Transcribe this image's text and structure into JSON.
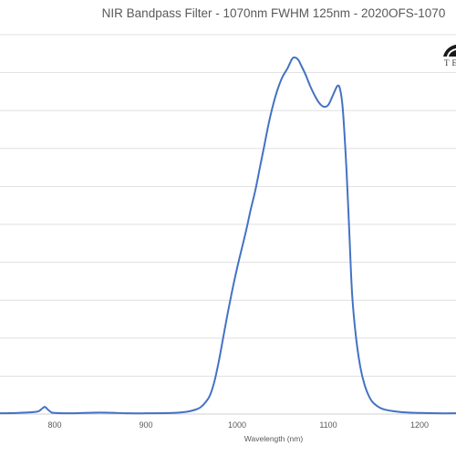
{
  "chart_data": {
    "type": "line",
    "title": "NIR Bandpass Filter - 1070nm FWHM 125nm - 2020OFS-1070",
    "xlabel": "Wavelength (nm)",
    "ylabel": "",
    "xlim": [
      740,
      1240
    ],
    "ylim": [
      0,
      100
    ],
    "x_ticks": [
      800,
      900,
      1000,
      1100,
      1200
    ],
    "x_tick_labels": [
      "800",
      "900",
      "1000",
      "1100",
      "1200"
    ],
    "y_gridlines": [
      0,
      10,
      20,
      30,
      40,
      50,
      60,
      70,
      80,
      90,
      100
    ],
    "grid": "horizontal",
    "legend": "none",
    "series": [
      {
        "color": "#4472C4",
        "x": [
          740,
          760,
          780,
          785,
          789,
          792,
          796,
          800,
          820,
          850,
          880,
          900,
          930,
          945,
          955,
          960,
          965,
          970,
          975,
          980,
          985,
          990,
          995,
          1000,
          1005,
          1010,
          1015,
          1020,
          1025,
          1030,
          1035,
          1040,
          1045,
          1050,
          1055,
          1060,
          1063,
          1067,
          1070,
          1075,
          1080,
          1085,
          1090,
          1095,
          1100,
          1105,
          1110,
          1113,
          1116,
          1120,
          1123,
          1126,
          1130,
          1135,
          1140,
          1145,
          1150,
          1160,
          1180,
          1200,
          1220,
          1240
        ],
        "y": [
          0.2,
          0.3,
          0.6,
          1.2,
          1.9,
          1.3,
          0.5,
          0.3,
          0.2,
          0.4,
          0.2,
          0.2,
          0.3,
          0.6,
          1.2,
          1.8,
          3.0,
          4.8,
          8.5,
          14.0,
          20.5,
          27.0,
          33.0,
          38.5,
          43.5,
          48.5,
          54.0,
          59.0,
          65.0,
          71.0,
          77.0,
          82.0,
          86.0,
          89.0,
          91.0,
          93.5,
          94.0,
          93.4,
          92.0,
          89.5,
          86.5,
          84.0,
          82.0,
          81.0,
          81.5,
          84.0,
          86.5,
          85.5,
          80.0,
          64.0,
          48.0,
          32.0,
          21.0,
          12.5,
          7.5,
          4.5,
          2.8,
          1.3,
          0.5,
          0.3,
          0.2,
          0.2
        ]
      }
    ]
  },
  "logo": {
    "text": "TE"
  }
}
